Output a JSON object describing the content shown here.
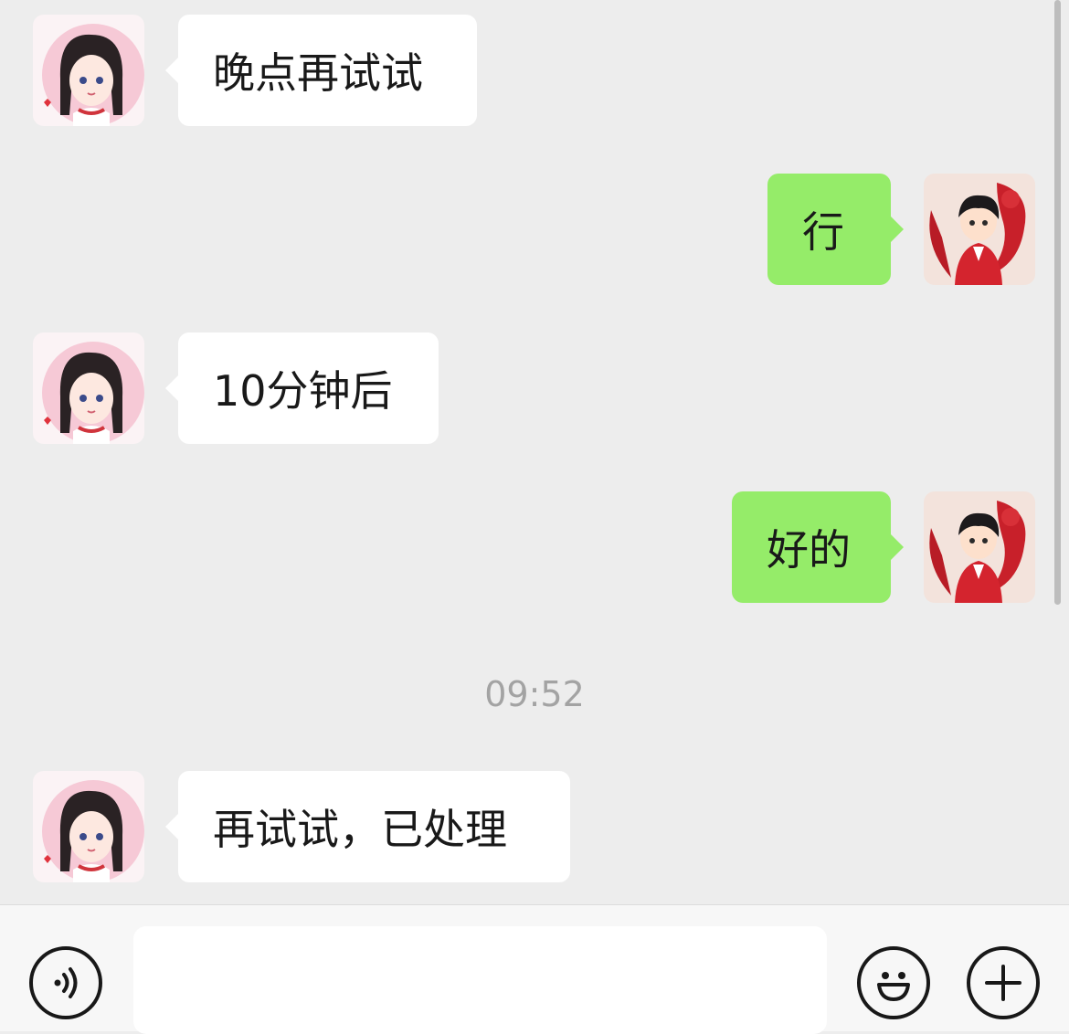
{
  "messages": [
    {
      "side": "in",
      "text": "晚点再试试"
    },
    {
      "side": "out",
      "text": "行"
    },
    {
      "side": "in",
      "text": "10分钟后"
    },
    {
      "side": "out",
      "text": "好的"
    },
    {
      "side": "in",
      "text": "再试试，已处理"
    }
  ],
  "timestamp": "09:52",
  "colors": {
    "background": "#ededed",
    "incoming_bubble": "#ffffff",
    "outgoing_bubble": "#95ec69",
    "timestamp_text": "#a3a3a3"
  },
  "input_bar": {
    "voice_icon": "voice-icon",
    "emoji_icon": "emoji-icon",
    "plus_icon": "plus-icon",
    "input_value": ""
  }
}
